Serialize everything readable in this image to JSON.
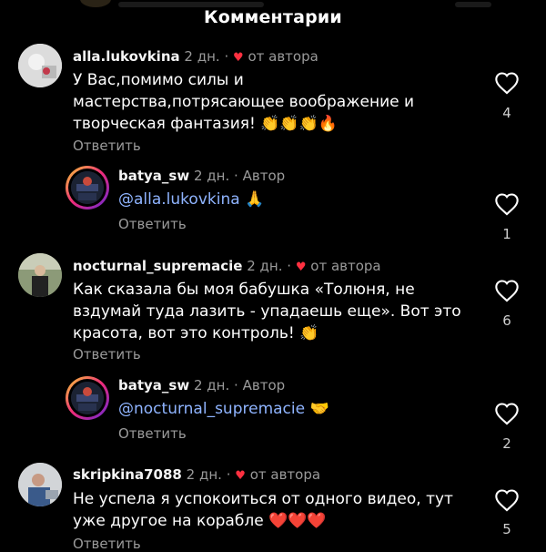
{
  "header": {
    "title": "Комментарии"
  },
  "comments": [
    {
      "username": "alla.lukovkina",
      "date": "2 дн.",
      "from_author": "от автора",
      "text": "У Вас,помимо силы и мастерства,потрясающее воображение и творческая фантазия!",
      "emoji": "👏👏👏🔥",
      "reply_label": "Ответить",
      "likes": "4"
    },
    {
      "username": "batya_sw",
      "date": "2 дн.",
      "author_tag": "Автор",
      "mention": "@alla.lukovkina",
      "emoji": "🙏",
      "reply_label": "Ответить",
      "likes": "1"
    },
    {
      "username": "nocturnal_supremacie",
      "date": "2 дн.",
      "from_author": "от автора",
      "text": "Как сказала бы моя бабушка «Толюня, не вздумай туда лазить - упадаешь еще». Вот это красота, вот это контроль!",
      "emoji": "👏",
      "reply_label": "Ответить",
      "likes": "6"
    },
    {
      "username": "batya_sw",
      "date": "2 дн.",
      "author_tag": "Автор",
      "mention": "@nocturnal_supremacie",
      "emoji": "🤝",
      "reply_label": "Ответить",
      "likes": "2"
    },
    {
      "username": "skripkina7088",
      "date": "2 дн.",
      "from_author": "от автора",
      "text": "Не успела я успокоиться от одного видео, тут уже другое на корабле",
      "emoji": "❤️❤️❤️",
      "reply_label": "Ответить",
      "likes": "5"
    }
  ],
  "icons": {
    "like": "heart-outline-icon",
    "author_like": "red-heart-icon"
  },
  "colors": {
    "background": "#000000",
    "mention": "#8fb4ff",
    "muted": "#9a9a9a",
    "heart": "#ff3040"
  }
}
